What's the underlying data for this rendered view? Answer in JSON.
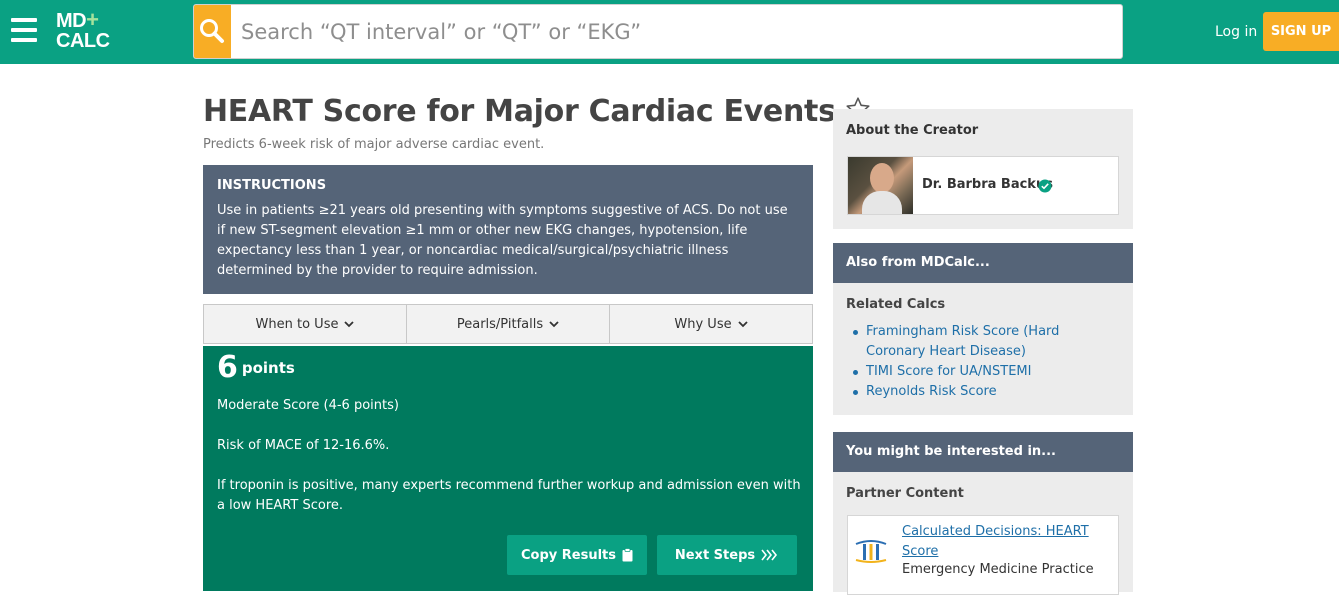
{
  "header": {
    "logo_line1": "MD",
    "logo_plus": "+",
    "logo_line2": "CALC",
    "search_placeholder": "Search “QT interval” or “QT” or “EKG”",
    "login_label": "Log in",
    "signup_label": "SIGN UP",
    "icons": [
      "hamburger-icon",
      "search-icon"
    ]
  },
  "main": {
    "title": "HEART Score for Major Cardiac Events",
    "subtitle": "Predicts 6-week risk of major adverse cardiac event.",
    "instructions": {
      "heading": "INSTRUCTIONS",
      "body": "Use in patients ≥21 years old presenting with symptoms suggestive of ACS. Do not use if new ST-segment elevation ≥1 mm or other new EKG changes, hypotension, life expectancy less than 1 year, or noncardiac medical/surgical/psychiatric illness determined by the provider to require admission."
    },
    "tabs": [
      {
        "label": "When to Use"
      },
      {
        "label": "Pearls/Pitfalls"
      },
      {
        "label": "Why Use"
      }
    ],
    "result": {
      "score": "6",
      "unit": "points",
      "category": "Moderate Score (4-6 points)",
      "risk": "Risk of MACE of 12-16.6%.",
      "note": "If troponin is positive, many experts recommend further workup and admission even with a low HEART Score.",
      "copy_label": "Copy Results",
      "next_label": "Next Steps"
    }
  },
  "sidebar": {
    "creator": {
      "heading": "About the Creator",
      "name": "Dr. Barbra Backus"
    },
    "also_from": {
      "heading": "Also from MDCalc...",
      "sub_heading": "Related Calcs",
      "items": [
        "Framingham Risk Score (Hard Coronary Heart Disease)",
        "TIMI Score for UA/NSTEMI",
        "Reynolds Risk Score"
      ]
    },
    "interested": {
      "heading": "You might be interested in...",
      "sub_heading": "Partner Content",
      "link": "Calculated Decisions: HEART Score",
      "source": "Emergency Medicine Practice"
    }
  },
  "colors": {
    "brand_green": "#0aa183",
    "result_green": "#007a5e",
    "accent_orange": "#f8ad25",
    "slate": "#556478",
    "link_blue": "#1e6fa8"
  }
}
